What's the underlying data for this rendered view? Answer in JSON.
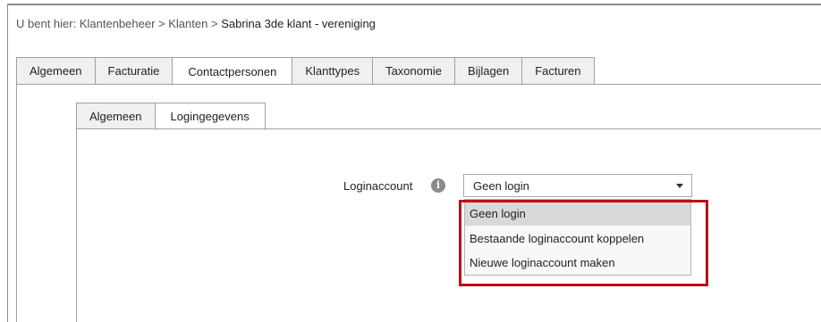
{
  "breadcrumb": {
    "prefix": "U bent hier:",
    "items": [
      "Klantenbeheer",
      "Klanten",
      "Sabrina 3de klant - vereniging"
    ],
    "separator": ">"
  },
  "main_tabs": [
    {
      "label": "Algemeen"
    },
    {
      "label": "Facturatie"
    },
    {
      "label": "Contactpersonen",
      "active": true
    },
    {
      "label": "Klanttypes"
    },
    {
      "label": "Taxonomie"
    },
    {
      "label": "Bijlagen"
    },
    {
      "label": "Facturen"
    }
  ],
  "sub_tabs": [
    {
      "label": "Algemeen"
    },
    {
      "label": "Logingegevens",
      "active": true
    }
  ],
  "login_field": {
    "label": "Loginaccount",
    "info_icon": "info-icon",
    "selected_value": "Geen login",
    "options": [
      "Geen login",
      "Bestaande loginaccount koppelen",
      "Nieuwe loginaccount maken"
    ]
  },
  "colors": {
    "highlight": "#b8111b",
    "tab_bg": "#f0f0f0",
    "selected_option_bg": "#d9d9d9"
  }
}
